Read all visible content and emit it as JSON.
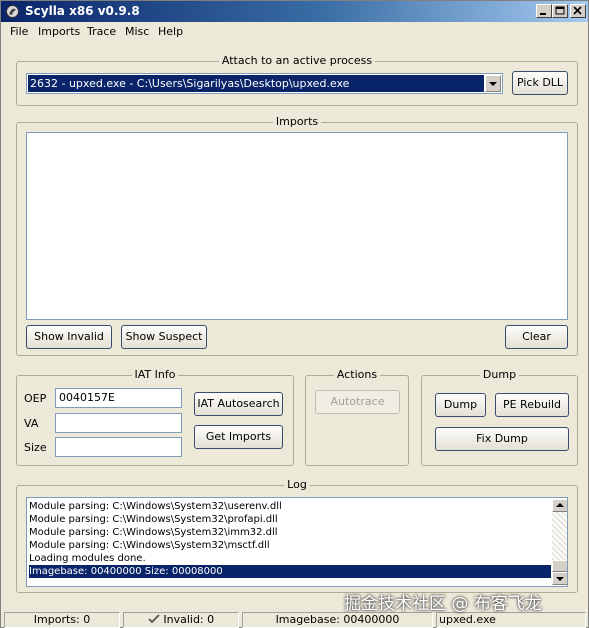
{
  "window": {
    "title": "Scylla x86 v0.9.8"
  },
  "menu": [
    "File",
    "Imports",
    "Trace",
    "Misc",
    "Help"
  ],
  "attach": {
    "group_label": "Attach to an active process",
    "selected_process": "2632 - upxed.exe - C:\\Users\\Sigarilyas\\Desktop\\upxed.exe",
    "pick_dll_label": "Pick DLL"
  },
  "imports": {
    "group_label": "Imports",
    "show_invalid_label": "Show Invalid",
    "show_suspect_label": "Show Suspect",
    "clear_label": "Clear"
  },
  "iat_info": {
    "group_label": "IAT Info",
    "oep_label": "OEP",
    "oep_value": "0040157E",
    "va_label": "VA",
    "va_value": "",
    "size_label": "Size",
    "size_value": "",
    "autosearch_label": "IAT Autosearch",
    "get_imports_label": "Get Imports"
  },
  "actions": {
    "group_label": "Actions",
    "autotrace_label": "Autotrace"
  },
  "dump": {
    "group_label": "Dump",
    "dump_label": "Dump",
    "pe_rebuild_label": "PE Rebuild",
    "fix_dump_label": "Fix Dump"
  },
  "log": {
    "group_label": "Log",
    "lines": [
      "Module parsing: C:\\Windows\\System32\\userenv.dll",
      "Module parsing: C:\\Windows\\System32\\profapi.dll",
      "Module parsing: C:\\Windows\\System32\\imm32.dll",
      "Module parsing: C:\\Windows\\System32\\msctf.dll",
      "Loading modules done.",
      "Imagebase: 00400000 Size: 00008000"
    ],
    "selected_index": 5
  },
  "status": {
    "imports": "Imports: 0",
    "invalid": "Invalid: 0",
    "imagebase": "Imagebase: 00400000",
    "module": "upxed.exe"
  },
  "watermark": "掘金技术社区 @ 布客飞龙"
}
